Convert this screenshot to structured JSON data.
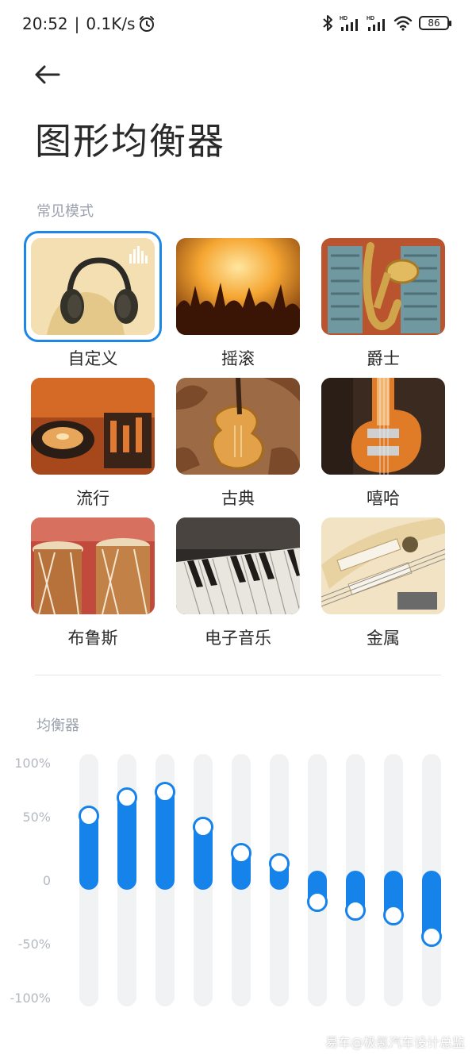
{
  "status_bar": {
    "time": "20:52",
    "speed": "0.1K/s",
    "battery": "86",
    "icons": [
      "alarm-icon",
      "bluetooth-icon",
      "signal-hd-icon",
      "signal-hd-icon",
      "wifi-icon",
      "battery-icon"
    ]
  },
  "header": {
    "title": "图形均衡器"
  },
  "presets": {
    "label": "常见模式",
    "items": [
      {
        "label": "自定义",
        "selected": true
      },
      {
        "label": "摇滚",
        "selected": false
      },
      {
        "label": "爵士",
        "selected": false
      },
      {
        "label": "流行",
        "selected": false
      },
      {
        "label": "古典",
        "selected": false
      },
      {
        "label": "嘻哈",
        "selected": false
      },
      {
        "label": "布鲁斯",
        "selected": false
      },
      {
        "label": "电子音乐",
        "selected": false
      },
      {
        "label": "金属",
        "selected": false
      }
    ]
  },
  "equalizer": {
    "label": "均衡器",
    "scale_labels": [
      "100%",
      "50%",
      "0",
      "-50%",
      "-100%"
    ],
    "band_levels": [
      55,
      70,
      75,
      45,
      23,
      14,
      -18,
      -26,
      -30,
      -48
    ],
    "accent_color": "#1583ea"
  },
  "watermark": "易车@极氪汽车设计总监"
}
